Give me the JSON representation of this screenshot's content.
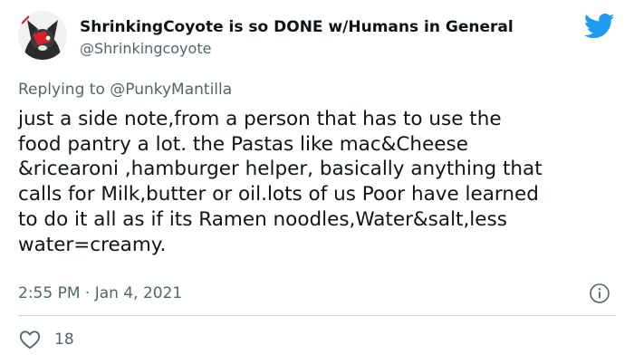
{
  "colors": {
    "text": "#0f1419",
    "secondary": "#536471",
    "twitter_blue": "#1d9bf0",
    "divider": "#cfd9de"
  },
  "author": {
    "display_name": "ShrinkingCoyote is so DONE w/Humans in General",
    "handle": "@Shrinkingcoyote",
    "avatar_icon": "dog-with-red-eyepatch-avatar"
  },
  "reply": {
    "prefix": "Replying to ",
    "to_handle": "@PunkyMantilla"
  },
  "tweet": {
    "lines": [
      "just a side note,from a person that has to use the",
      "food pantry a lot. the Pastas like mac&Cheese",
      "&ricearoni ,hamburger helper, basically anything that",
      "calls for Milk,butter or oil.lots of us Poor have learned",
      "to do it all as if its Ramen noodles,Water&salt,less",
      "water=creamy."
    ]
  },
  "meta": {
    "time": "2:55 PM",
    "separator": " · ",
    "date": "Jan 4, 2021"
  },
  "actions": {
    "like_count": "18"
  },
  "icons": {
    "brand": "twitter-bird-icon",
    "info": "info-icon",
    "like": "heart-icon"
  }
}
